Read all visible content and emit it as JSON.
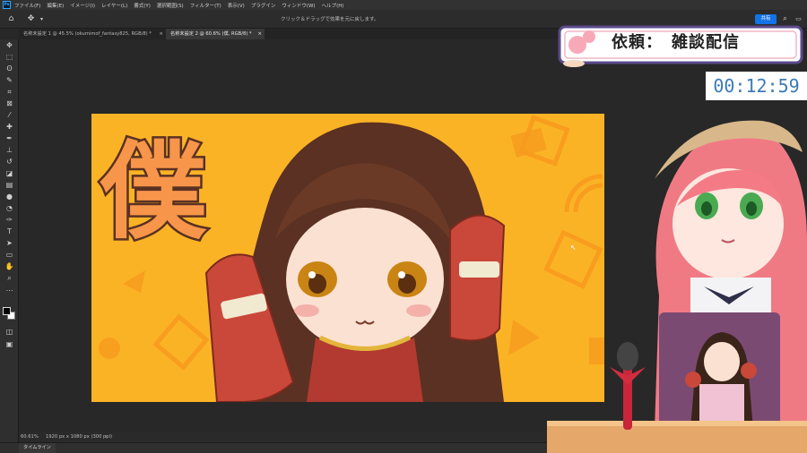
{
  "app": {
    "logo": "Ps",
    "menu": [
      "ファイル(F)",
      "編集(E)",
      "イメージ(I)",
      "レイヤー(L)",
      "書式(Y)",
      "選択範囲(S)",
      "フィルター(T)",
      "表示(V)",
      "プラグイン",
      "ウィンドウ(W)",
      "ヘルプ(H)"
    ]
  },
  "options_bar": {
    "hint": "クリック＆ドラッグで効果を元に戻します。",
    "share_label": "共有"
  },
  "tabs": [
    {
      "label": "名称未設定 1 @ 45.5% (okumimof_fantasy825, RGB/8) *",
      "active": false
    },
    {
      "label": "名称未設定 2 @ 60.6% (僕, RGB/8) *",
      "active": true
    }
  ],
  "status": {
    "zoom": "60.61%",
    "doc_size": "1920 px x 1080 px (300 ppi)"
  },
  "timeline_label": "タイムライン",
  "artwork": {
    "big_text": "僕"
  },
  "overlay": {
    "title": "依頼：　雑談配信",
    "timer": "00:12:59"
  },
  "colors": {
    "canvas_bg": "#fbb326",
    "accent_blue": "#1473e6",
    "timer_text": "#3c7ab8",
    "banner_border": "#5b4a8c"
  }
}
